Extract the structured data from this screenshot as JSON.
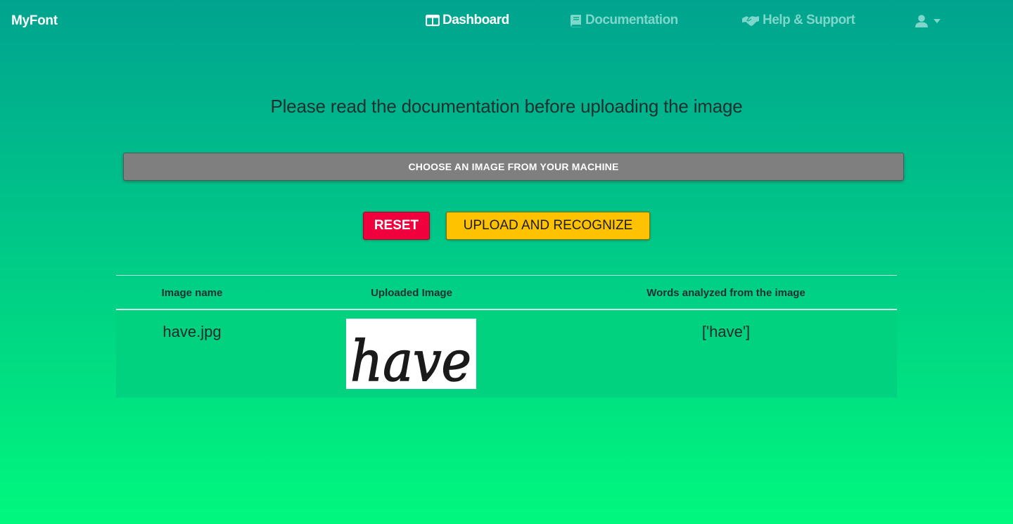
{
  "brand": "MyFont",
  "nav": {
    "dashboard": "Dashboard",
    "documentation": "Documentation",
    "help": "Help & Support"
  },
  "icons": {
    "dashboard": "columns-icon",
    "documentation": "book-icon",
    "help": "handshake-icon",
    "user": "user-icon",
    "user_dropdown": "caret-down-icon"
  },
  "headline": "Please read the documentation before uploading the image",
  "buttons": {
    "choose": "CHOOSE AN IMAGE FROM YOUR MACHINE",
    "reset": "RESET",
    "upload": "UPLOAD AND RECOGNIZE"
  },
  "table": {
    "headers": [
      "Image name",
      "Uploaded Image",
      "Words analyzed from the image"
    ],
    "rows": [
      {
        "image_name": "have.jpg",
        "image_text": "have",
        "words": "['have']"
      }
    ]
  },
  "colors": {
    "reset": "#f0003c",
    "upload": "#ffc200",
    "choose": "#7f7f7f",
    "row": "#00d27f"
  }
}
